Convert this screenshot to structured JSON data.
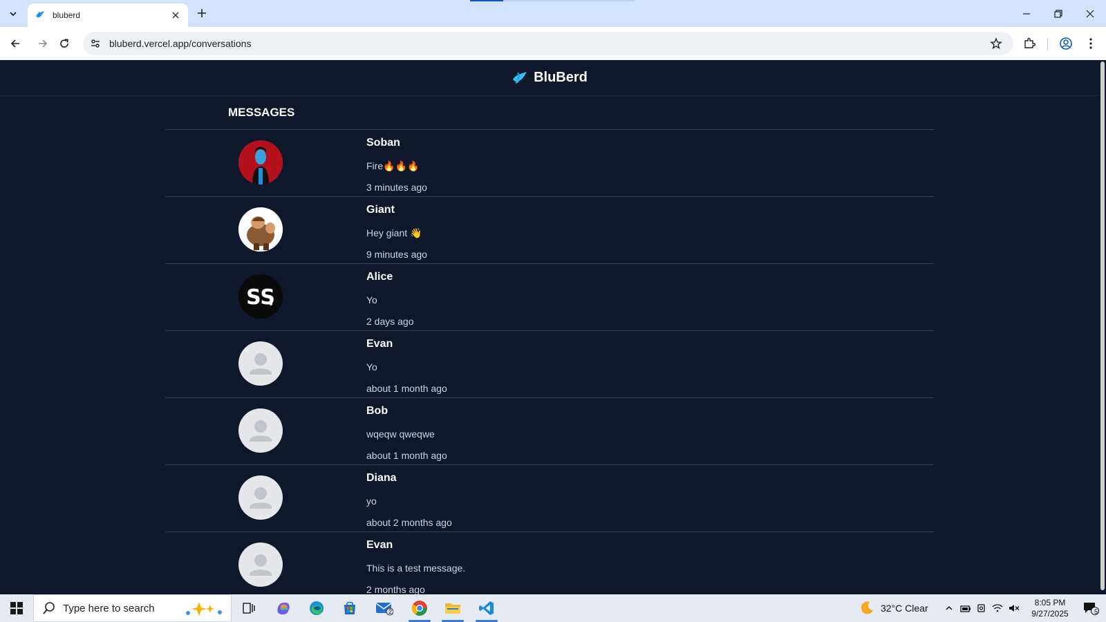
{
  "browser": {
    "tab_title": "bluberd",
    "url": "bluberd.vercel.app/conversations"
  },
  "app": {
    "brand": "BluBerd",
    "section_title": "MESSAGES"
  },
  "conversations": [
    {
      "name": "Soban",
      "message": "Fire🔥🔥🔥",
      "time": "3 minutes ago",
      "avatar": "red-figure-avatar"
    },
    {
      "name": "Giant",
      "message": "Hey giant 👋",
      "time": "9 minutes ago",
      "avatar": "giant-avatar"
    },
    {
      "name": "Alice",
      "message": "Yo",
      "time": "2 days ago",
      "avatar": "ss-logo-avatar"
    },
    {
      "name": "Evan",
      "message": "Yo",
      "time": "about 1 month ago",
      "avatar": "default-avatar"
    },
    {
      "name": "Bob",
      "message": "wqeqw qweqwe",
      "time": "about 1 month ago",
      "avatar": "default-avatar"
    },
    {
      "name": "Diana",
      "message": "yo",
      "time": "about 2 months ago",
      "avatar": "default-avatar"
    },
    {
      "name": "Evan",
      "message": "This is a test message.",
      "time": "2 months ago",
      "avatar": "default-avatar"
    }
  ],
  "taskbar": {
    "search_placeholder": "Type here to search",
    "weather": "32°C Clear",
    "time": "8:05 PM",
    "date": "9/27/2025",
    "mail_badge": "2",
    "notif_count": "5"
  }
}
